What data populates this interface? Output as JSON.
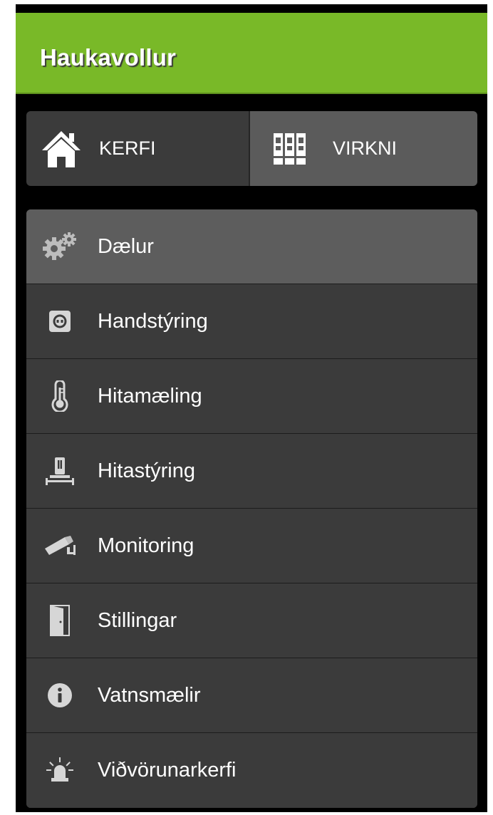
{
  "header": {
    "title": "Haukavollur",
    "color": "#79b928"
  },
  "tabs": [
    {
      "label": "KERFI",
      "icon": "home-icon",
      "selected": false
    },
    {
      "label": "VIRKNI",
      "icon": "binders-icon",
      "selected": true
    }
  ],
  "menu": {
    "items": [
      {
        "label": "Dælur",
        "icon": "gears-icon",
        "active": true
      },
      {
        "label": "Handstýring",
        "icon": "power-socket-icon",
        "active": false
      },
      {
        "label": "Hitamæling",
        "icon": "thermometer-icon",
        "active": false
      },
      {
        "label": "Hitastýring",
        "icon": "thermostat-icon",
        "active": false
      },
      {
        "label": "Monitoring",
        "icon": "security-camera-icon",
        "active": false
      },
      {
        "label": "Stillingar",
        "icon": "door-icon",
        "active": false
      },
      {
        "label": "Vatnsmælir",
        "icon": "info-icon",
        "active": false
      },
      {
        "label": "Viðvörunarkerfi",
        "icon": "alarm-siren-icon",
        "active": false
      }
    ]
  }
}
